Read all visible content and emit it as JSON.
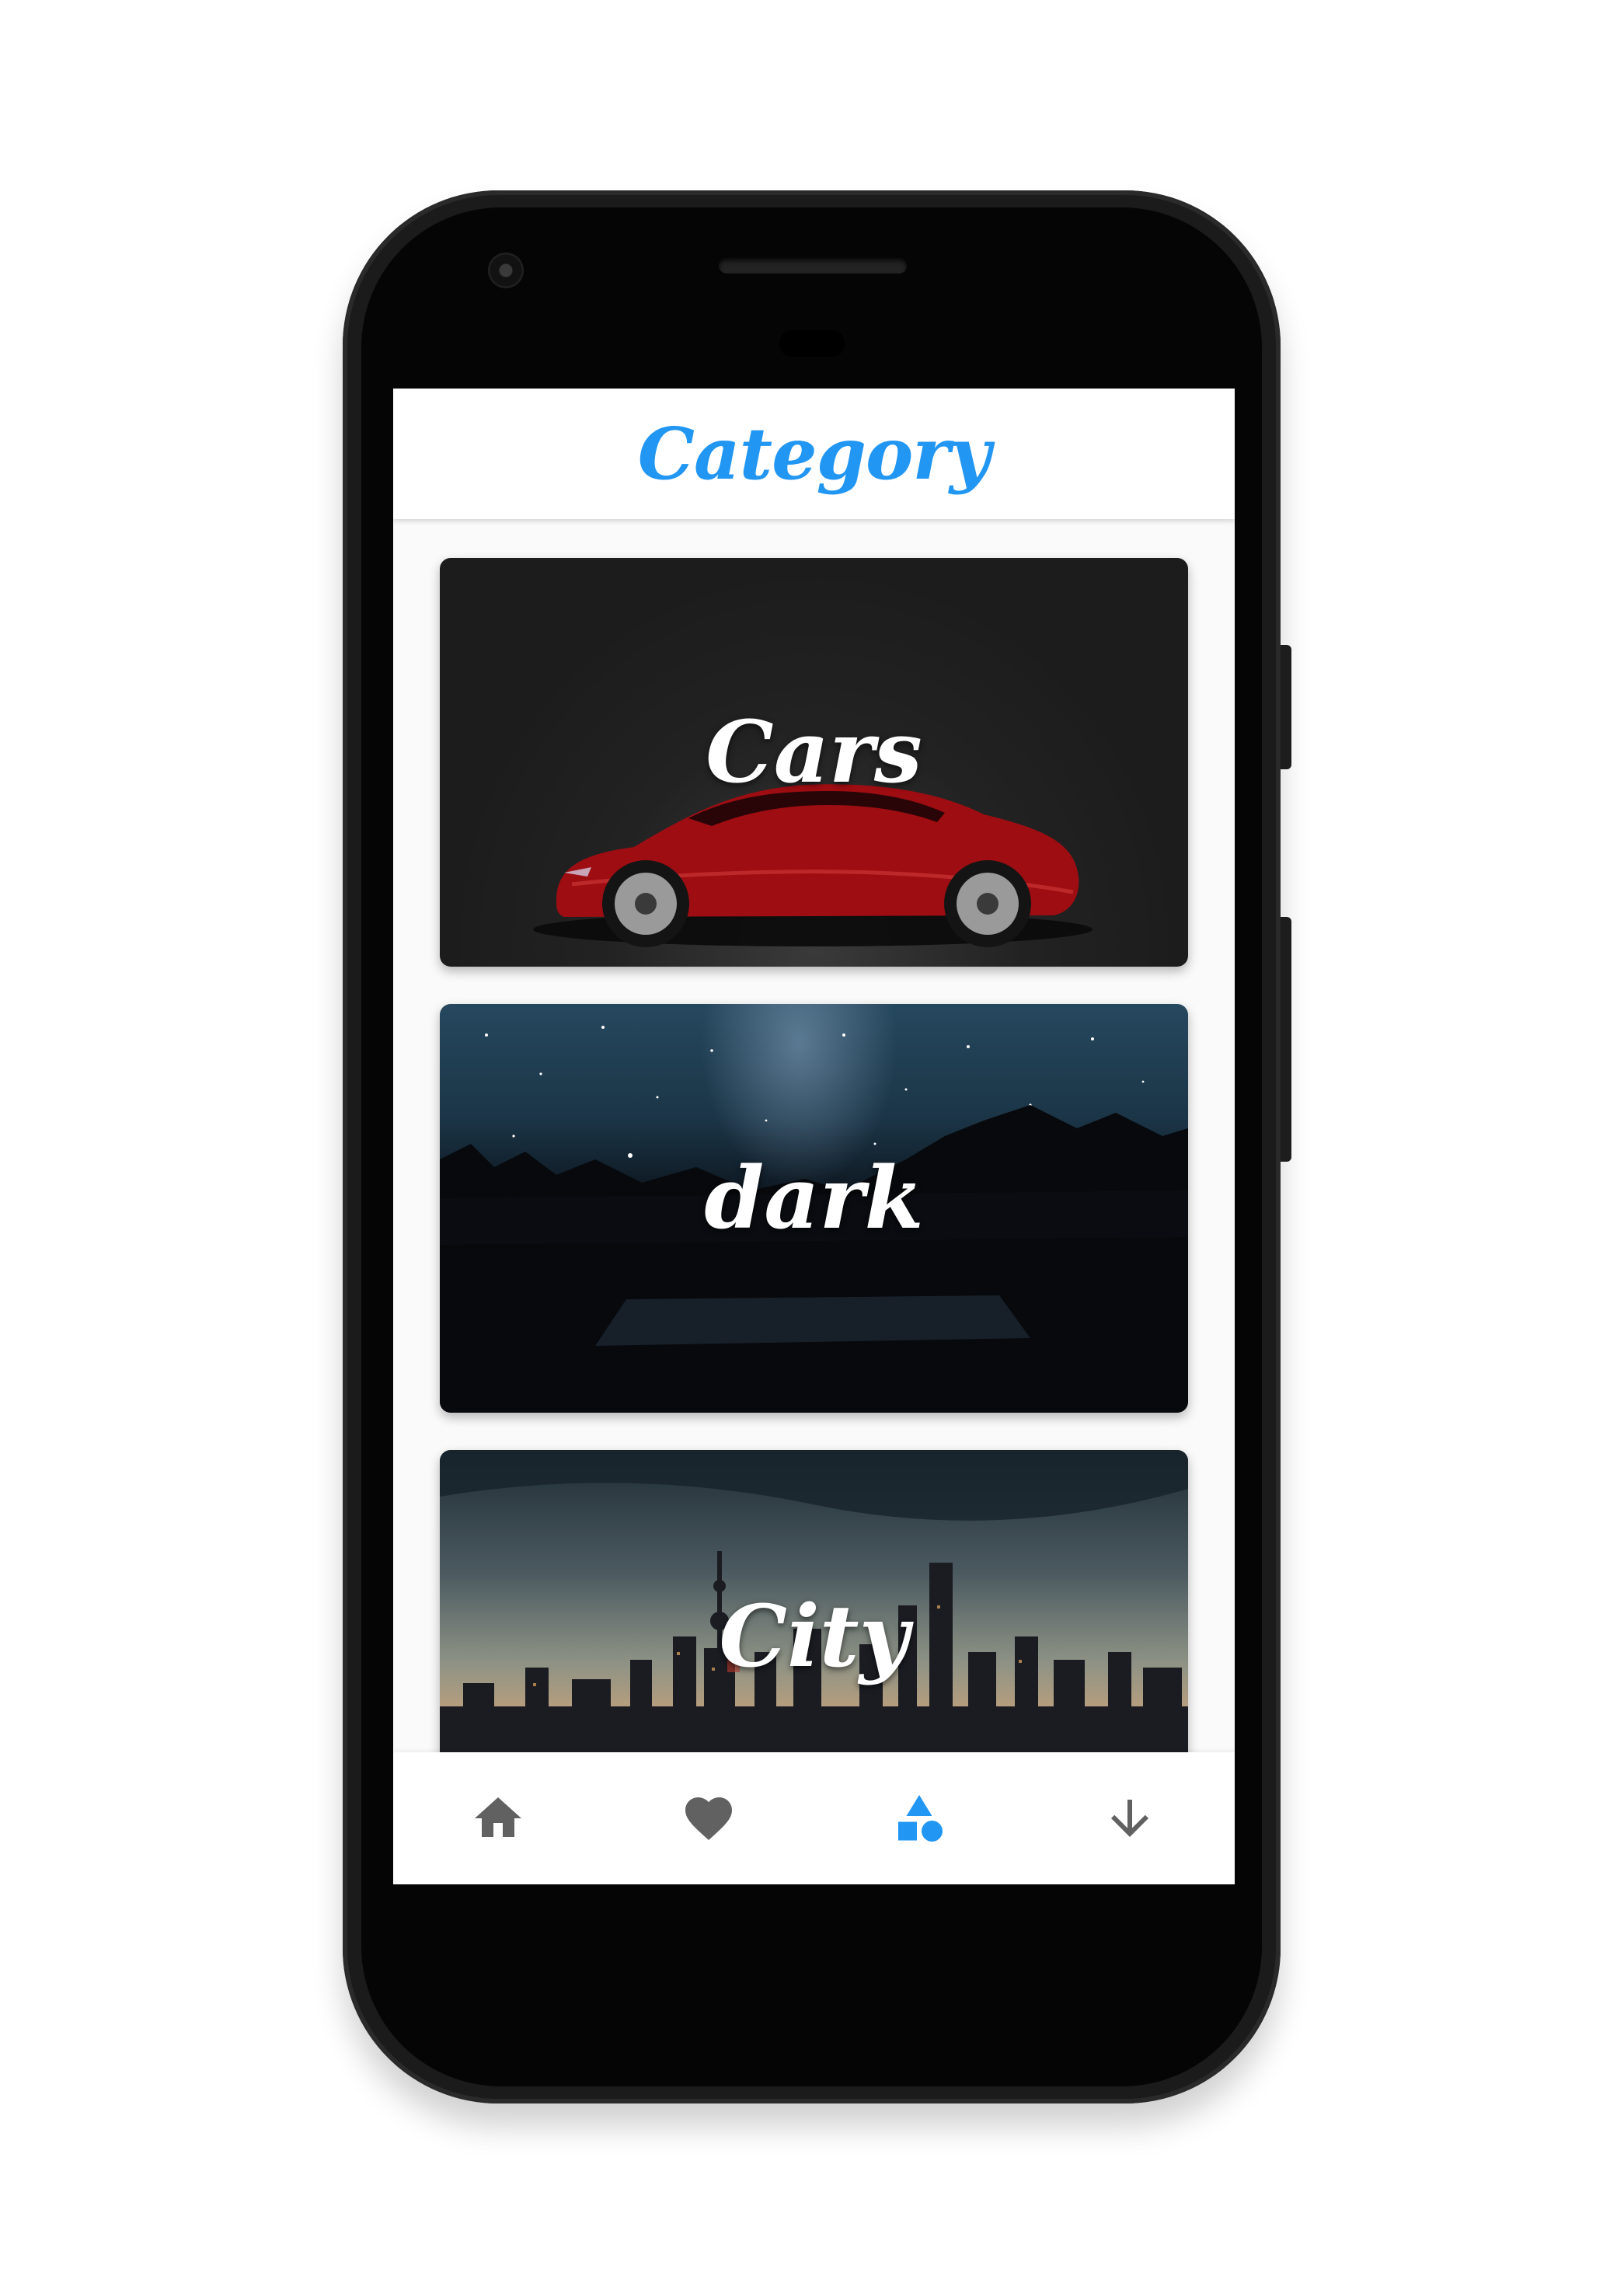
{
  "app_bar": {
    "title": "Category"
  },
  "categories": [
    {
      "label": "Cars"
    },
    {
      "label": "dark"
    },
    {
      "label": "City"
    }
  ],
  "bottom_nav": {
    "items": [
      {
        "icon": "home-icon",
        "active": false
      },
      {
        "icon": "heart-icon",
        "active": false
      },
      {
        "icon": "category-shapes-icon",
        "active": true
      },
      {
        "icon": "download-arrow-icon",
        "active": false
      }
    ]
  },
  "colors": {
    "accent": "#2196f3",
    "inactive_icon": "#616161",
    "card_text": "#ffffff"
  }
}
